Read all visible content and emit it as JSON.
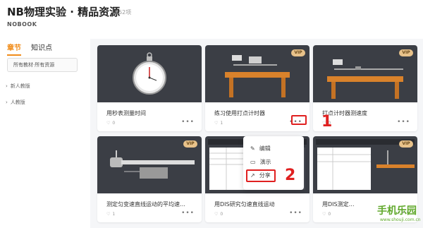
{
  "header": {
    "title": "NB物理实验 · 精品资源",
    "count": "252项",
    "brand": "NOBOOK"
  },
  "sidebar": {
    "tabs": [
      {
        "label": "章节",
        "active": true
      },
      {
        "label": "知识点",
        "active": false
      }
    ],
    "filter_label": "所有教材·所有资源",
    "items": [
      {
        "label": "新人教版"
      },
      {
        "label": "人教版"
      }
    ]
  },
  "cards": [
    {
      "title": "用秒表测量时间",
      "likes": "0",
      "vip": false,
      "more": "•••"
    },
    {
      "title": "练习使用打点计时器",
      "likes": "1",
      "vip": true,
      "vip_label": "VIP",
      "more": "•••"
    },
    {
      "title": "打点计时器测速度",
      "likes": "0",
      "vip": true,
      "vip_label": "VIP",
      "more": "•••"
    },
    {
      "title": "测定匀变速直线运动的平均速…",
      "likes": "1",
      "vip": true,
      "vip_label": "VIP",
      "more": "•••"
    },
    {
      "title": "用DIS研究匀速直线运动",
      "likes": "0",
      "vip": false,
      "more": "•••"
    },
    {
      "title": "用DIS测定…",
      "likes": "0",
      "vip": true,
      "vip_label": "VIP",
      "more": "•••"
    }
  ],
  "context_menu": {
    "items": [
      {
        "label": "编辑",
        "icon": "edit-icon"
      },
      {
        "label": "演示",
        "icon": "present-icon"
      },
      {
        "label": "分享",
        "icon": "share-icon"
      }
    ]
  },
  "annotations": {
    "step1": "1",
    "step2": "2"
  },
  "watermark": {
    "text": "手机乐园",
    "url": "www.shouji.com.cn"
  },
  "colors": {
    "accent": "#f08c1a",
    "annotation": "#e02020",
    "thumb_bg": "#3b3e45",
    "vip": "#e8c28a"
  }
}
